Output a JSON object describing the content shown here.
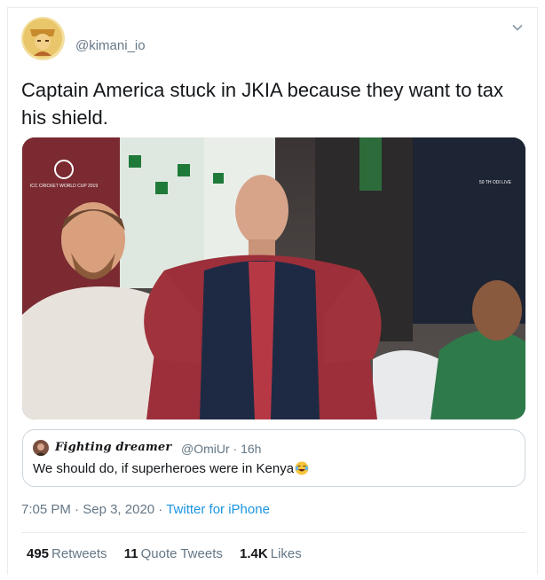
{
  "tweet": {
    "handle": "@kimani_io",
    "text": "Captain America stuck in JKIA because they want to tax his shield.",
    "time": "7:05 PM",
    "date": "Sep 3, 2020",
    "source": "Twitter for iPhone",
    "separator": "·"
  },
  "media": {
    "overlay_logo_left": "ICC CRICKET WORLD CUP 2019",
    "overlay_logo_right": "50 TH ODI LIVE"
  },
  "quote": {
    "name": "Fighting dreamer",
    "handle": "@OmiUr",
    "age": "16h",
    "text": "We should do, if superheroes were in Kenya"
  },
  "stats": {
    "retweets_count": "495",
    "retweets_label": "Retweets",
    "quotes_count": "11",
    "quotes_label": "Quote Tweets",
    "likes_count": "1.4K",
    "likes_label": "Likes"
  },
  "icons": {
    "menu": "chevron-down-icon",
    "emoji": "laughing-tears-emoji-icon"
  },
  "colors": {
    "link": "#1b95e0",
    "secondary_text": "#657786",
    "border": "#e6ecf0"
  }
}
